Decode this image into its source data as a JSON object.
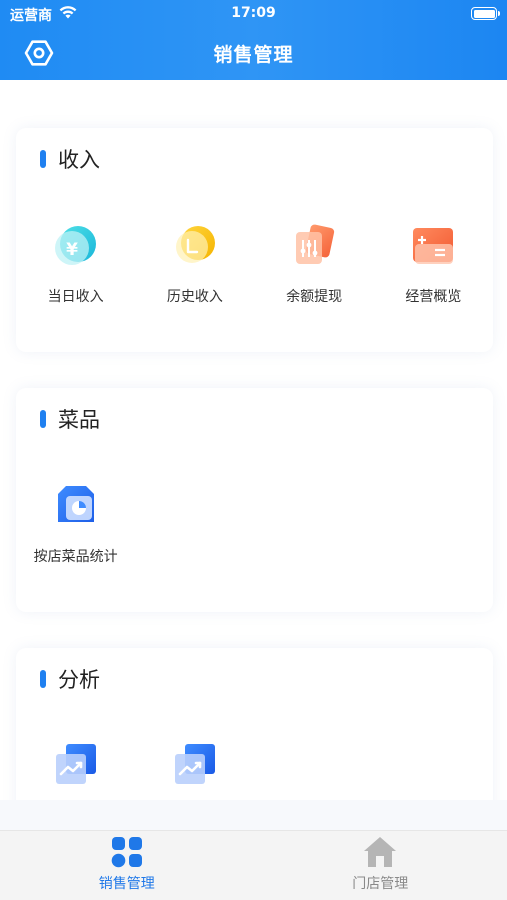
{
  "status_bar": {
    "carrier": "运营商",
    "time": "17:09"
  },
  "header": {
    "title": "销售管理",
    "settings_icon": "settings-hexagon-icon"
  },
  "sections": [
    {
      "title": "收入",
      "items": [
        {
          "label": "当日收入",
          "icon": "yen-coin-icon"
        },
        {
          "label": "历史收入",
          "icon": "gold-coin-icon"
        },
        {
          "label": "余额提现",
          "icon": "sliders-wallet-icon"
        },
        {
          "label": "经营概览",
          "icon": "calculator-icon"
        }
      ]
    },
    {
      "title": "菜品",
      "items": [
        {
          "label": "按店菜品统计",
          "icon": "store-chart-icon"
        }
      ]
    },
    {
      "title": "分析",
      "items": [
        {
          "label": "",
          "icon": "trend-chart-icon"
        },
        {
          "label": "",
          "icon": "trend-chart-icon"
        }
      ]
    }
  ],
  "tabbar": {
    "tabs": [
      {
        "label": "销售管理",
        "icon": "grid-apps-icon",
        "active": true
      },
      {
        "label": "门店管理",
        "icon": "home-icon",
        "active": false
      }
    ]
  },
  "colors": {
    "header_blue": "#1f8bf3",
    "accent_blue": "#1f80f0",
    "tab_active": "#1f78e8",
    "tab_inactive": "#8a8a8a"
  }
}
